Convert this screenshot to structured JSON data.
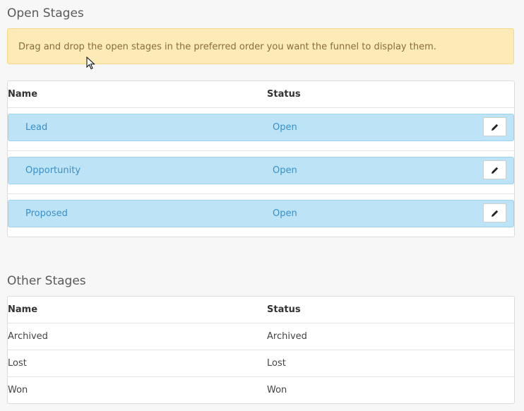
{
  "open_stages": {
    "title": "Open Stages",
    "info": "Drag and drop the open stages in the preferred order you want the funnel to display them.",
    "columns": {
      "name": "Name",
      "status": "Status"
    },
    "rows": [
      {
        "name": "Lead",
        "status": "Open",
        "edit_icon": "pencil-icon"
      },
      {
        "name": "Opportunity",
        "status": "Open",
        "edit_icon": "pencil-icon"
      },
      {
        "name": "Proposed",
        "status": "Open",
        "edit_icon": "pencil-icon"
      }
    ]
  },
  "other_stages": {
    "title": "Other Stages",
    "columns": {
      "name": "Name",
      "status": "Status"
    },
    "rows": [
      {
        "name": "Archived",
        "status": "Archived"
      },
      {
        "name": "Lost",
        "status": "Lost"
      },
      {
        "name": "Won",
        "status": "Won"
      }
    ]
  },
  "colors": {
    "stage_row_bg": "#bde3f6",
    "stage_text": "#3a8fc7",
    "alert_bg": "#fcebb6",
    "alert_text": "#8a6d3b"
  }
}
